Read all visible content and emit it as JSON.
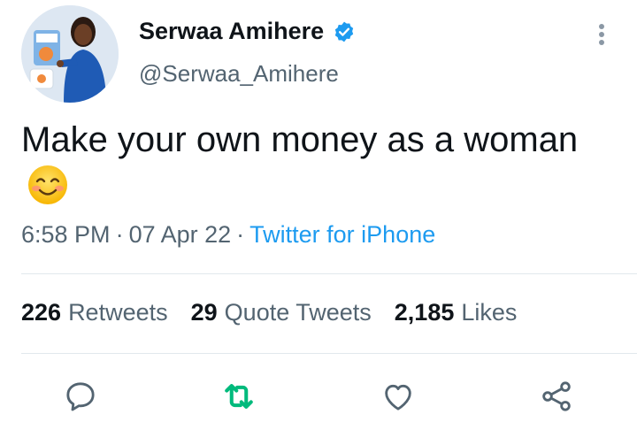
{
  "user": {
    "display_name": "Serwaa Amihere",
    "handle": "@Serwaa_Amihere",
    "verified": true,
    "avatar_icon": "profile-photo"
  },
  "tweet": {
    "text": "Make your own money as a woman",
    "emoji_icon": "smiling-face-with-smiling-eyes-emoji"
  },
  "meta": {
    "time": "6:58 PM",
    "date": "07 Apr 22",
    "separator": "·",
    "source": "Twitter for iPhone"
  },
  "stats": [
    {
      "count": "226",
      "label": "Retweets"
    },
    {
      "count": "29",
      "label": "Quote Tweets"
    },
    {
      "count": "2,185",
      "label": "Likes"
    }
  ],
  "actions": [
    {
      "name": "reply",
      "icon": "speech-bubble-icon"
    },
    {
      "name": "retweet",
      "icon": "retweet-icon"
    },
    {
      "name": "like",
      "icon": "heart-icon"
    },
    {
      "name": "share",
      "icon": "share-icon"
    }
  ],
  "colors": {
    "text": "#0f1419",
    "secondary": "#536471",
    "link": "#1d9bf0",
    "verified": "#1d9bf0",
    "retweet_active": "#00ba7c",
    "divider": "#e1e8ed"
  }
}
